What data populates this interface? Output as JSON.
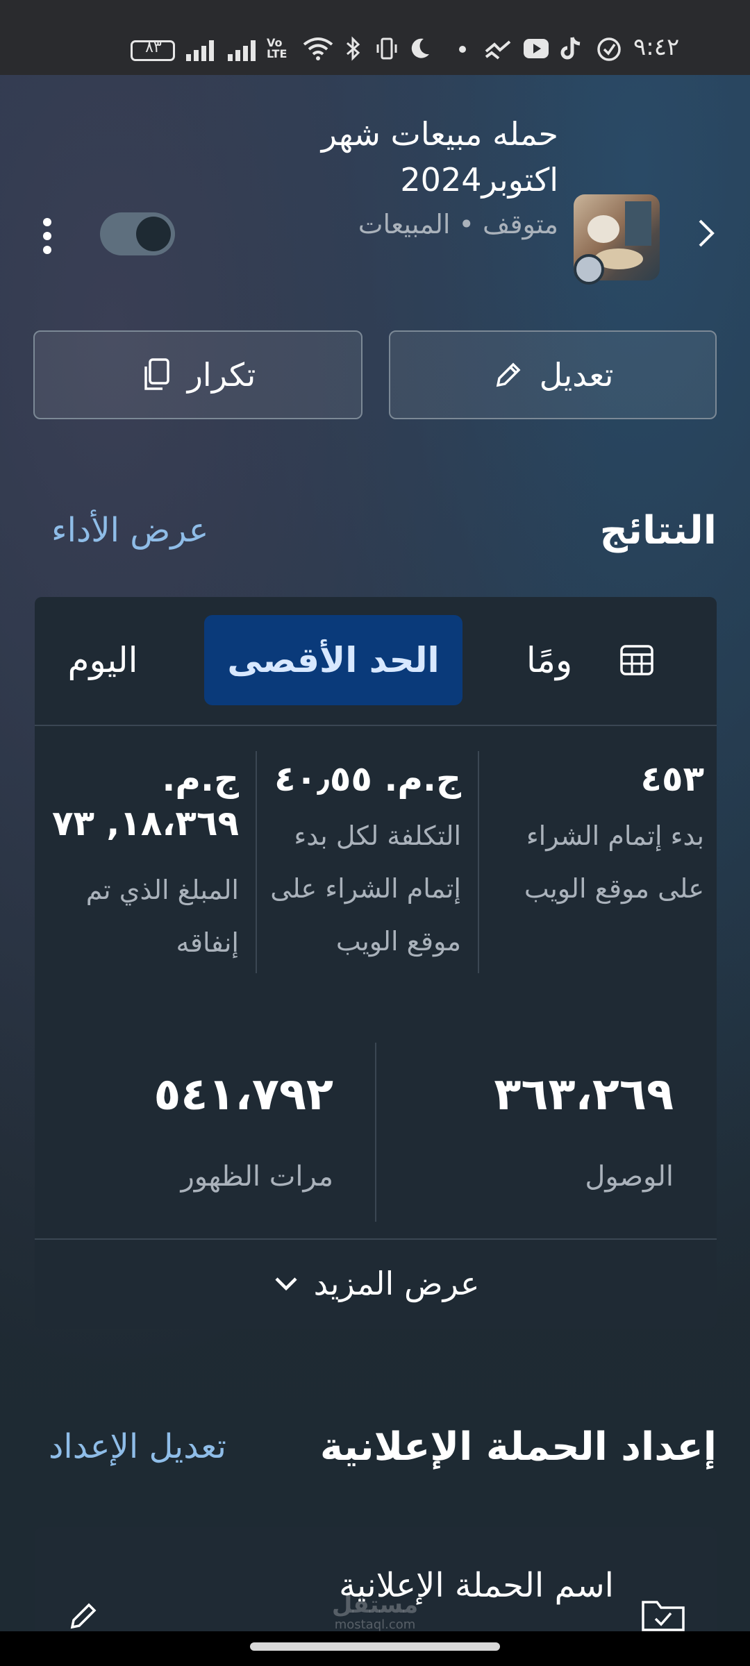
{
  "status_bar": {
    "time": "٩:٤٢",
    "battery": "٨٣"
  },
  "campaign": {
    "title": "حمله مبيعات شهر اكتوبر2024",
    "subtitle": "متوقف • المبيعات",
    "toggle_on": false
  },
  "actions": {
    "edit_label": "تعديل",
    "duplicate_label": "تكرار"
  },
  "results": {
    "title": "النتائج",
    "view_performance": "عرض الأداء",
    "tabs": [
      {
        "label": "اليوم"
      },
      {
        "label": "الحد الأقصى",
        "active": true
      },
      {
        "label": "ومًا"
      }
    ],
    "metrics": [
      {
        "value": "٤٥٣",
        "label": "بدء إتمام الشراء على موقع الويب"
      },
      {
        "value": "ج.م. ٤٠٫٥٥",
        "label": "التكلفة لكل بدء إتمام الشراء على موقع الويب"
      },
      {
        "value": "ج.م. ١٨،٣٦٩, ٧٣",
        "label": "المبلغ الذي تم إنفاقه"
      }
    ],
    "reach": {
      "value": "٣٦٣،٢٦٩",
      "label": "الوصول"
    },
    "impressions": {
      "value": "٥٤١،٧٩٢",
      "label": "مرات الظهور"
    },
    "show_more": "عرض المزيد"
  },
  "setup": {
    "title": "إعداد الحملة الإعلانية",
    "edit_setup": "تعديل الإعداد",
    "campaign_name_label": "اسم الحملة الإعلانية"
  },
  "watermark": {
    "arabic": "مستقل",
    "latin": "mostaql.com"
  }
}
